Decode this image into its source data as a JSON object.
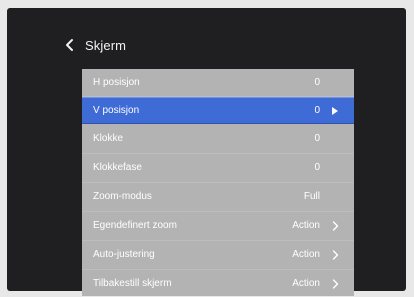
{
  "header": {
    "title": "Skjerm"
  },
  "menu": {
    "items": [
      {
        "label": "H posisjon",
        "value": "0",
        "arrow": "none",
        "selected": false
      },
      {
        "label": "V posisjon",
        "value": "0",
        "arrow": "triangle-right-icon",
        "selected": true
      },
      {
        "label": "Klokke",
        "value": "0",
        "arrow": "none",
        "selected": false
      },
      {
        "label": "Klokkefase",
        "value": "0",
        "arrow": "none",
        "selected": false
      },
      {
        "label": "Zoom-modus",
        "value": "Full",
        "arrow": "none",
        "selected": false
      },
      {
        "label": "Egendefinert zoom",
        "value": "Action",
        "arrow": "chevron-right-icon",
        "selected": false
      },
      {
        "label": "Auto-justering",
        "value": "Action",
        "arrow": "chevron-right-icon",
        "selected": false
      },
      {
        "label": "Tilbakestill skjerm",
        "value": "Action",
        "arrow": "chevron-right-icon",
        "selected": false
      }
    ]
  },
  "colors": {
    "window_bg": "#1f1f21",
    "panel_bg": "#b3b3b3",
    "selected_bg": "#3f6bd6",
    "text": "#ffffff"
  }
}
